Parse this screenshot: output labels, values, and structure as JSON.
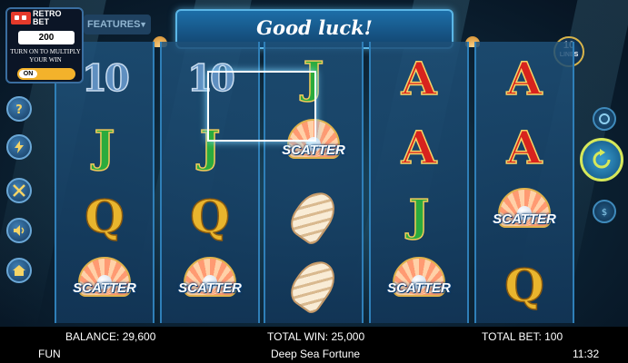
{
  "retro_bet": {
    "logo_line1": "RETRO",
    "logo_line2": "BET",
    "amount": "200",
    "instructions": "TURN ON TO MULTIPLY YOUR WIN",
    "toggle_label": "ON"
  },
  "features_label": "FEATURES",
  "banner_message": "Good luck!",
  "lines": {
    "count": "10",
    "label": "LINES"
  },
  "side_buttons": [
    "help-icon",
    "lightning-icon",
    "settings-icon",
    "sound-icon",
    "home-icon"
  ],
  "reels": [
    [
      "10",
      "J",
      "Q",
      "SCATTER"
    ],
    [
      "10",
      "J",
      "Q",
      "SCATTER"
    ],
    [
      "J",
      "SCATTER",
      "CONCH",
      "CONCH"
    ],
    [
      "A",
      "A",
      "J",
      "SCATTER"
    ],
    [
      "A",
      "A",
      "SCATTER",
      "Q"
    ]
  ],
  "scatter_text": "SCATTER",
  "status": {
    "balance": "BALANCE: 29,600",
    "total_win": "TOTAL WIN: 25,000",
    "total_bet": "TOTAL BET: 100",
    "mode": "FUN",
    "game_name": "Deep Sea Fortune",
    "time": "11:32"
  },
  "colors": {
    "accent": "#5bb6e6",
    "spin_ring": "#d6e85a",
    "retro_red": "#e53a2b"
  }
}
